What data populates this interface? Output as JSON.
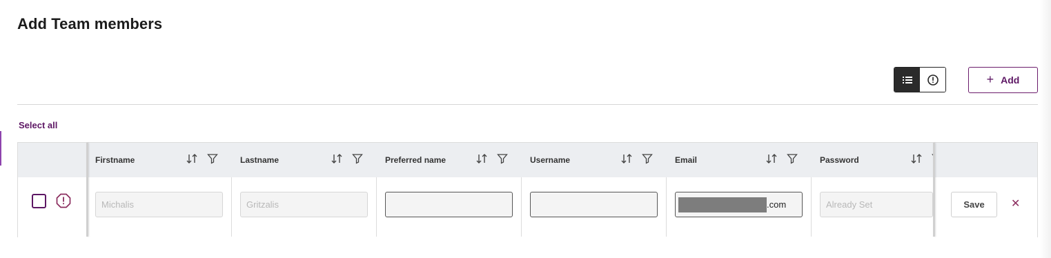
{
  "page": {
    "title": "Add Team members"
  },
  "toolbar": {
    "list_view_icon": "list-icon",
    "warning_view_icon": "warning-circle-icon",
    "add_label": "Add",
    "add_icon": "plus"
  },
  "table": {
    "select_all_label": "Select all",
    "columns": [
      {
        "label": "Firstname"
      },
      {
        "label": "Lastname"
      },
      {
        "label": "Preferred name"
      },
      {
        "label": "Username"
      },
      {
        "label": "Email"
      },
      {
        "label": "Password"
      }
    ],
    "rows": [
      {
        "checked": false,
        "firstname_placeholder": "Michalis",
        "lastname_placeholder": "Gritzalis",
        "preferred_name_value": "",
        "username_value": "",
        "email_suffix": ".com",
        "password_placeholder": "Already Set",
        "save_label": "Save",
        "delete_label": "✕"
      }
    ]
  },
  "colors": {
    "accent": "#5d1764",
    "header_bg": "#eceef1",
    "toggle_active": "#2b2b2b"
  }
}
